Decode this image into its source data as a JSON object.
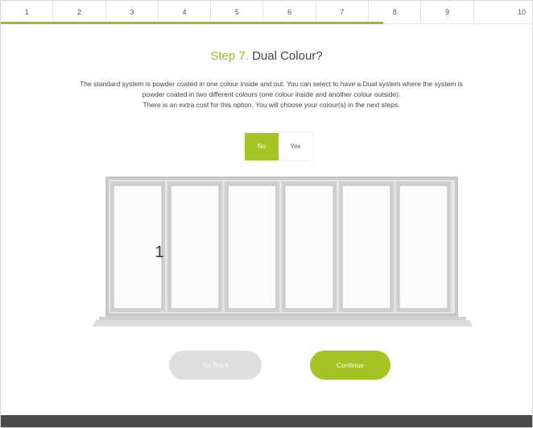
{
  "steps": [
    "1",
    "2",
    "3",
    "4",
    "5",
    "6",
    "7",
    "8",
    "9",
    "10"
  ],
  "progress_fraction": 0.72,
  "heading": {
    "step": "Step 7.",
    "title": "Dual Colour?"
  },
  "description": [
    "The standard system is powder coated in one colour inside and out. You can select to have a Dual system where the system is",
    "powder coated in two different colours (one colour inside and another colour outside).",
    "There is an extra cost for this option. You will choose your colour(s) in the next steps."
  ],
  "toggle": {
    "no_label": "No",
    "yes_label": "Yes",
    "selected": "No"
  },
  "door": {
    "handle_label": "1",
    "panel_count": 6
  },
  "buttons": {
    "back": "Go Back",
    "continue": "Continue"
  },
  "colors": {
    "accent": "#a4c424",
    "frame": "#c8c8c8",
    "glass": "#fbfbfb",
    "footer": "#4a4a4a"
  }
}
